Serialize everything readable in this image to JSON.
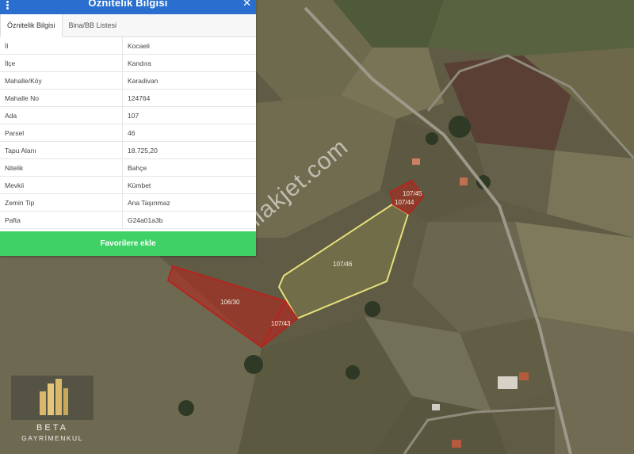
{
  "panel": {
    "title": "Öznitelik Bilgisi",
    "close_glyph": "✕",
    "tabs": [
      {
        "label": "Öznitelik Bilgisi",
        "active": true
      },
      {
        "label": "Bina/BB Listesi",
        "active": false
      }
    ],
    "rows": [
      {
        "key": "İl",
        "value": "Kocaeli"
      },
      {
        "key": "İlçe",
        "value": "Kandıra"
      },
      {
        "key": "Mahalle/Köy",
        "value": "Karadivan"
      },
      {
        "key": "Mahalle No",
        "value": "124764"
      },
      {
        "key": "Ada",
        "value": "107"
      },
      {
        "key": "Parsel",
        "value": "46"
      },
      {
        "key": "Tapu Alanı",
        "value": "18.725,20"
      },
      {
        "key": "Nitelik",
        "value": "Bahçe"
      },
      {
        "key": "Mevkii",
        "value": "Kümbet"
      },
      {
        "key": "Zemin Tip",
        "value": "Ana Taşınmaz"
      },
      {
        "key": "Pafta",
        "value": "G24a01a3b"
      }
    ],
    "favorite_button": "Favorilere ekle"
  },
  "map": {
    "parcel_labels": {
      "p107_45": "107/45",
      "p107_44": "107/44",
      "p107_46": "107/46",
      "p106_30": "106/30",
      "p107_43": "107/43"
    }
  },
  "watermark": "emlakjet.com",
  "logo": {
    "line1": "BETA",
    "line2": "GAYRİMENKUL"
  },
  "colors": {
    "header_blue": "#2a6fd0",
    "button_green": "#3fd165",
    "selected_parcel_outline": "#e6e07a",
    "red_parcel_fill": "#b3261e"
  },
  "icons": [
    "menu-icon",
    "close-icon"
  ]
}
